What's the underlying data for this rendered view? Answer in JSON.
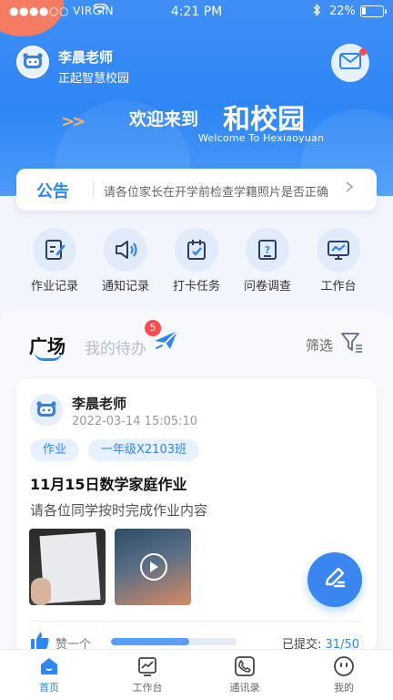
{
  "status_bar": {
    "carrier": "●●●●○○ VIRGIN",
    "time": "4:21 PM",
    "battery": "22%",
    "battery_level": 0.22
  },
  "header": {
    "user_name": "李晨老师",
    "school": "正起智慧校园"
  },
  "banner": {
    "arrows": ">>",
    "welcome": "欢迎来到",
    "app_name": "和校园",
    "english": "Welcome To Hexiaoyuan"
  },
  "notice": {
    "tag": "公告",
    "text": "请各位家长在开学前检查学籍照片是否正确"
  },
  "quick_actions": [
    {
      "label": "作业记录",
      "icon": "homework-icon"
    },
    {
      "label": "通知记录",
      "icon": "announcement-icon"
    },
    {
      "label": "打卡任务",
      "icon": "checkin-icon"
    },
    {
      "label": "问卷调查",
      "icon": "survey-icon"
    },
    {
      "label": "工作台",
      "icon": "workbench-icon"
    }
  ],
  "feed_tabs": {
    "plaza": "广场",
    "todo": "我的待办",
    "todo_badge": "5",
    "filter": "筛选"
  },
  "post": {
    "author": "李晨老师",
    "time": "2022-03-14 15:05:10",
    "tags": [
      "作业",
      "一年级X2103班"
    ],
    "title": "11月15日数学家庭作业",
    "body": "请各位同学按时完成作业内容",
    "like_label": "赞一个",
    "submitted_label": "已提交:",
    "submitted_count": "31/50",
    "progress": 0.62
  },
  "tabbar": [
    {
      "label": "首页",
      "active": true
    },
    {
      "label": "工作台",
      "active": false
    },
    {
      "label": "通讯录",
      "active": false
    },
    {
      "label": "我的",
      "active": false
    }
  ],
  "colors": {
    "primary": "#2f86f6",
    "badge": "#ff4d4f",
    "accent_orange": "#ffb162"
  }
}
